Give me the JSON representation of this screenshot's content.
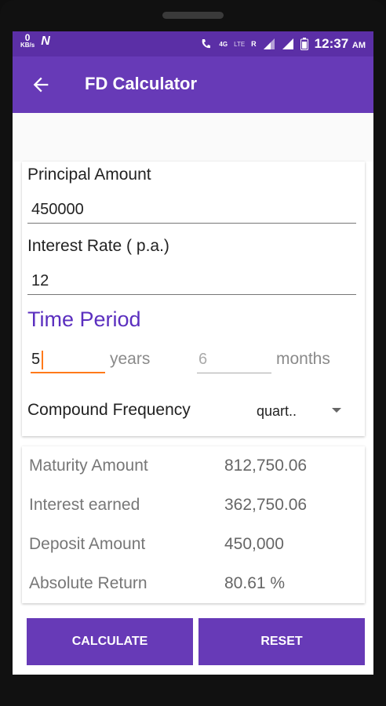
{
  "status_bar": {
    "kbs_value": "0",
    "kbs_unit": "KB/s",
    "notification": "N",
    "network": "4G",
    "lte": "LTE",
    "roaming": "R",
    "time": "12:37",
    "ampm": "AM"
  },
  "app_bar": {
    "title": "FD Calculator"
  },
  "form": {
    "principal_label": "Principal Amount",
    "principal_value": "450000",
    "rate_label": "Interest Rate ( p.a.)",
    "rate_value": "12",
    "time_period_label": "Time Period",
    "years_value": "5",
    "years_label": "years",
    "months_placeholder": "6",
    "months_label": "months",
    "compound_label": "Compound Frequency",
    "compound_value": "quart.."
  },
  "results": [
    {
      "label": "Maturity Amount",
      "value": "812,750.06"
    },
    {
      "label": "Interest earned",
      "value": "362,750.06"
    },
    {
      "label": "Deposit Amount",
      "value": "450,000"
    },
    {
      "label": "Absolute Return",
      "value": "80.61 %"
    }
  ],
  "buttons": {
    "calculate": "CALCULATE",
    "reset": "RESET"
  },
  "colors": {
    "primary": "#673ab7",
    "status_bar": "#5b2fa6",
    "accent": "#ff7a1a"
  }
}
